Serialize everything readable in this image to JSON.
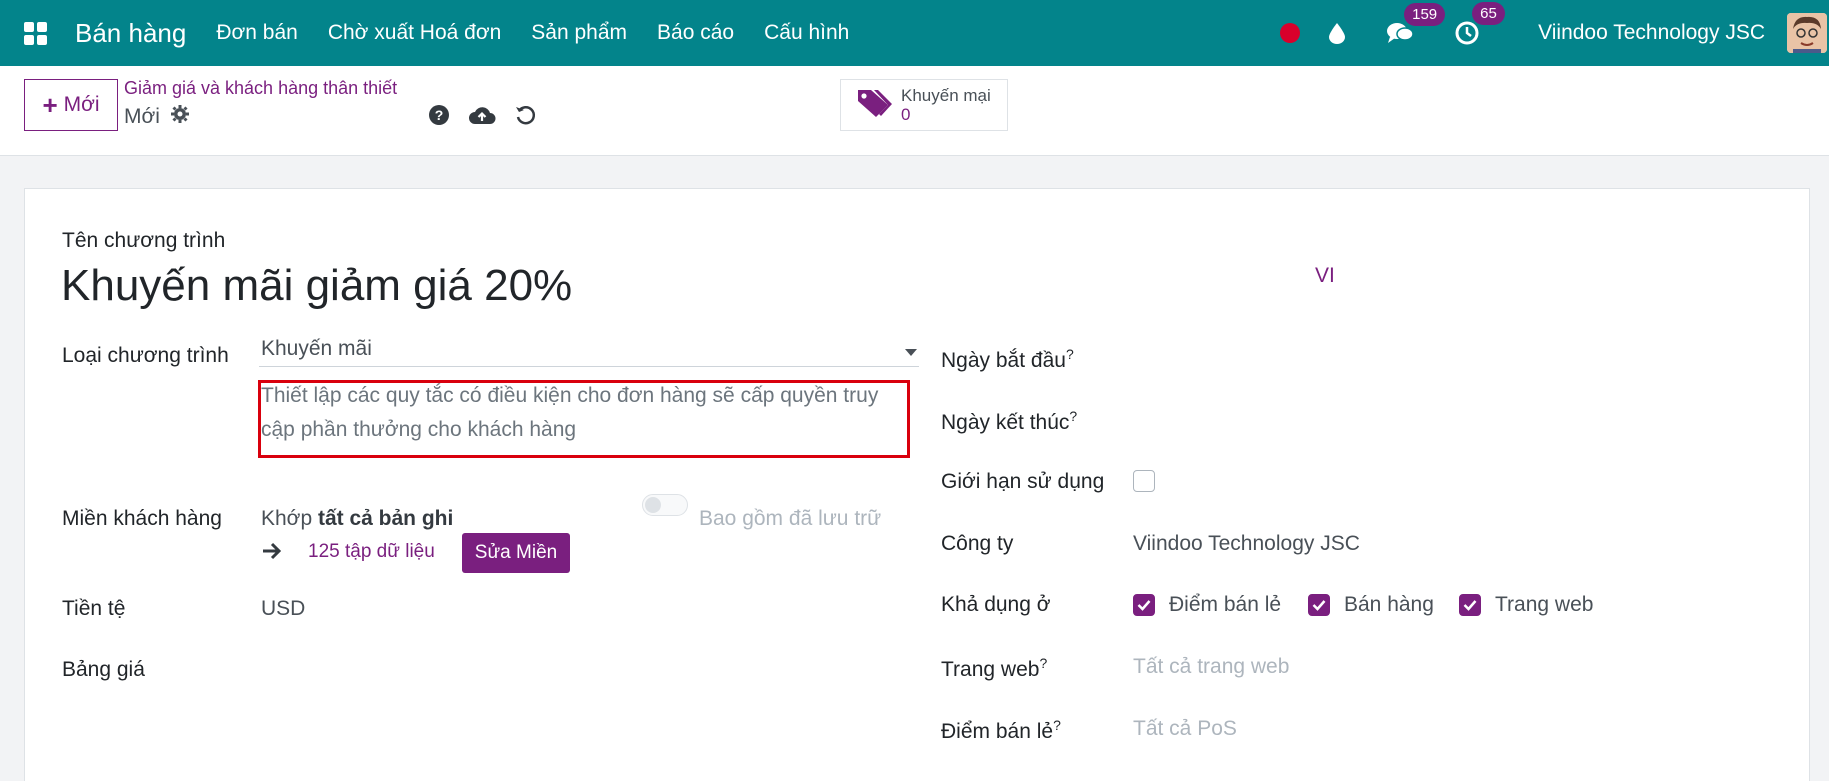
{
  "navbar": {
    "app_title": "Bán hàng",
    "menu": [
      "Đơn bán",
      "Chờ xuất Hoá đơn",
      "Sản phẩm",
      "Báo cáo",
      "Cấu hình"
    ],
    "messages_count": "159",
    "activities_count": "65",
    "company": "Viindoo Technology JSC"
  },
  "control_panel": {
    "new_label": "Mới",
    "breadcrumb": "Giảm giá và khách hàng thân thiết",
    "record_name": "Mới",
    "smart_button": {
      "label": "Khuyến mại",
      "value": "0"
    }
  },
  "form": {
    "program_name_label": "Tên chương trình",
    "program_name": "Khuyến mãi giảm giá 20%",
    "lang": "VI",
    "program_type_label": "Loại chương trình",
    "program_type_value": "Khuyến mãi",
    "program_type_help": "Thiết lập các quy tắc có điều kiện cho đơn hàng sẽ cấp quyền truy cập phần thưởng cho khách hàng",
    "customer_domain_label": "Miền khách hàng",
    "match_prefix": "Khớp ",
    "match_all": "tất cả bản ghi",
    "include_archived_label": "Bao gồm đã lưu trữ",
    "records_link": "125 tập dữ liệu",
    "edit_domain_label": "Sửa Miền",
    "currency_label": "Tiền tệ",
    "currency_value": "USD",
    "pricelist_label": "Bảng giá",
    "start_date_label": "Ngày bắt đầu",
    "end_date_label": "Ngày kết thúc",
    "limit_usage_label": "Giới hạn sử dụng",
    "company_label": "Công ty",
    "company_value": "Viindoo Technology JSC",
    "available_on_label": "Khả dụng ở",
    "available_on": [
      "Điểm bán lẻ",
      "Bán hàng",
      "Trang web"
    ],
    "website_label": "Trang web",
    "website_placeholder": "Tất cả trang web",
    "pos_label": "Điểm bán lẻ",
    "pos_placeholder": "Tất cả PoS",
    "help_mark": "?"
  },
  "colors": {
    "navbar": "#03848b",
    "primary": "#7a1f7f",
    "highlight": "#d9000d"
  }
}
